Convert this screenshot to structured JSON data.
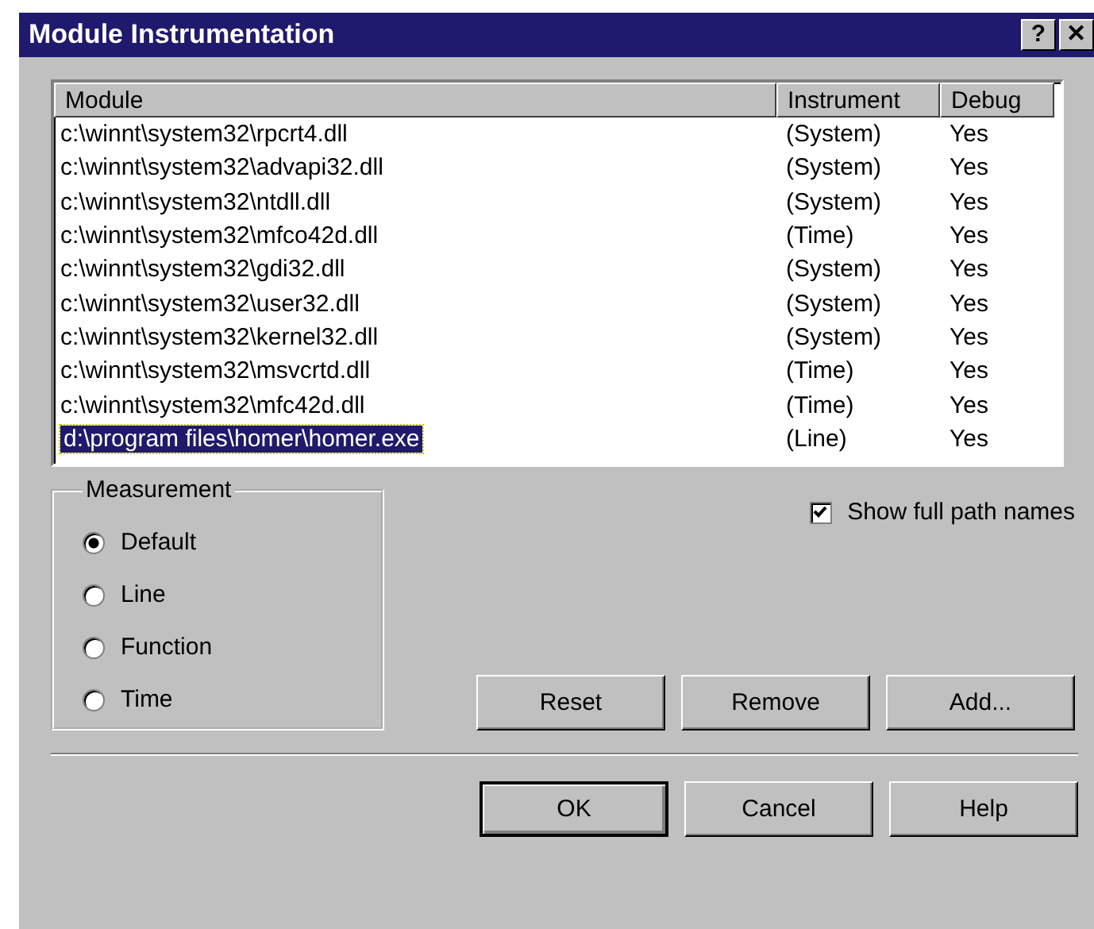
{
  "window": {
    "title": "Module Instrumentation",
    "title_buttons": [
      "?",
      "✕"
    ]
  },
  "table": {
    "columns": [
      "Module",
      "Instrument",
      "Debug"
    ],
    "rows": [
      {
        "cells": [
          "c:\\winnt\\system32\\rpcrt4.dll",
          "(System)",
          "Yes"
        ],
        "selected": false
      },
      {
        "cells": [
          "c:\\winnt\\system32\\advapi32.dll",
          "(System)",
          "Yes"
        ],
        "selected": false
      },
      {
        "cells": [
          "c:\\winnt\\system32\\ntdll.dll",
          "(System)",
          "Yes"
        ],
        "selected": false
      },
      {
        "cells": [
          "c:\\winnt\\system32\\mfco42d.dll",
          "(Time)",
          "Yes"
        ],
        "selected": false
      },
      {
        "cells": [
          "c:\\winnt\\system32\\gdi32.dll",
          "(System)",
          "Yes"
        ],
        "selected": false
      },
      {
        "cells": [
          "c:\\winnt\\system32\\user32.dll",
          "(System)",
          "Yes"
        ],
        "selected": false
      },
      {
        "cells": [
          "c:\\winnt\\system32\\kernel32.dll",
          "(System)",
          "Yes"
        ],
        "selected": false
      },
      {
        "cells": [
          "c:\\winnt\\system32\\msvcrtd.dll",
          "(Time)",
          "Yes"
        ],
        "selected": false
      },
      {
        "cells": [
          "c:\\winnt\\system32\\mfc42d.dll",
          "(Time)",
          "Yes"
        ],
        "selected": false
      },
      {
        "cells": [
          "d:\\program files\\homer\\homer.exe",
          "(Line)",
          "Yes"
        ],
        "selected": true
      }
    ]
  },
  "measurement": {
    "title": "Measurement",
    "options": [
      {
        "label": "Default",
        "selected": true
      },
      {
        "label": "Line",
        "selected": false
      },
      {
        "label": "Function",
        "selected": false
      },
      {
        "label": "Time",
        "selected": false
      }
    ]
  },
  "show_full_path": {
    "label": "Show full path names",
    "checked": true
  },
  "buttons": [
    {
      "label": "Reset",
      "default": false
    },
    {
      "label": "Remove",
      "default": false
    },
    {
      "label": "Add...",
      "default": false
    }
  ],
  "dialog_buttons": [
    {
      "label": "OK",
      "default": true
    },
    {
      "label": "Cancel",
      "default": false
    },
    {
      "label": "Help",
      "default": false
    }
  ]
}
